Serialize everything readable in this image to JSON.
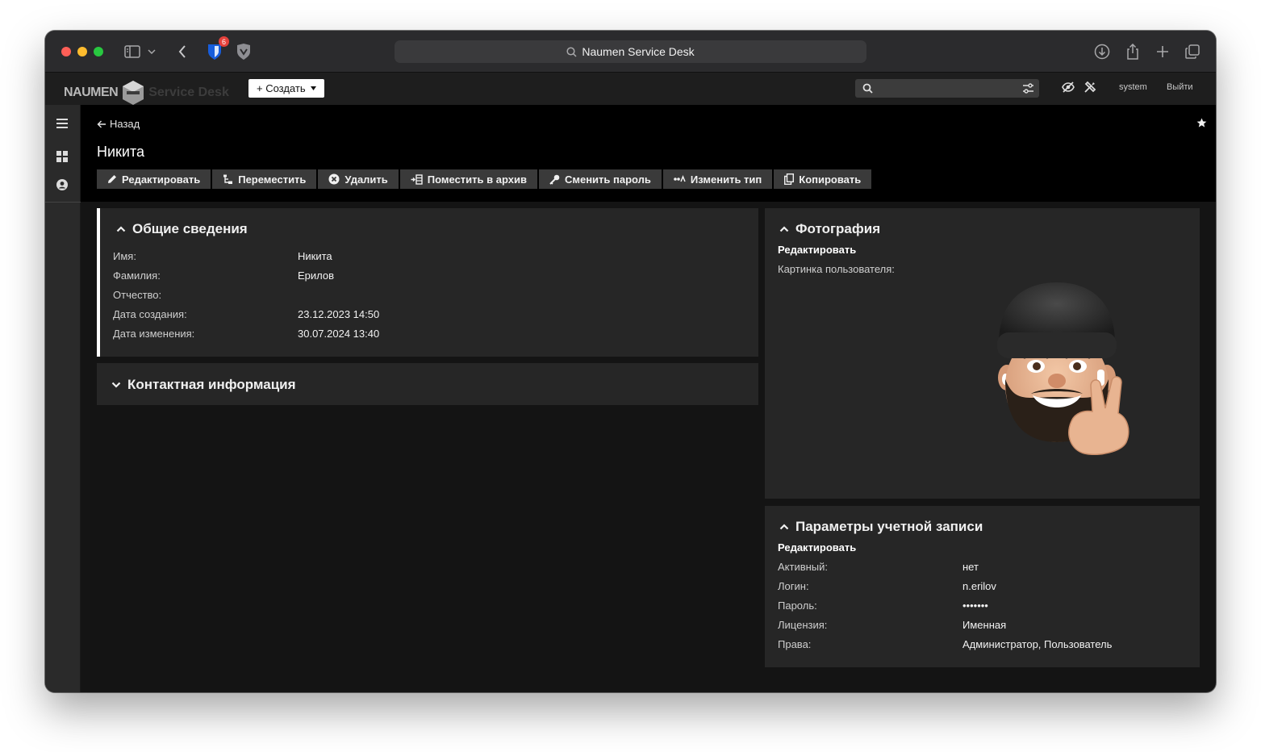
{
  "browser": {
    "address_text": "Naumen Service Desk",
    "extension_badge": "6"
  },
  "app": {
    "logo_text": "NAUMEN",
    "logo_sub": "Service Desk",
    "create_label": "+ Создать",
    "user_label": "system",
    "logout_label": "Выйти",
    "search_placeholder": ""
  },
  "page": {
    "back_label": "Назад",
    "title": "Никита",
    "actions": [
      {
        "label": "Редактировать",
        "icon": "pencil-icon"
      },
      {
        "label": "Переместить",
        "icon": "move-icon"
      },
      {
        "label": "Удалить",
        "icon": "delete-icon"
      },
      {
        "label": "Поместить в архив",
        "icon": "archive-icon"
      },
      {
        "label": "Сменить пароль",
        "icon": "key-icon"
      },
      {
        "label": "Изменить тип",
        "icon": "change-type-icon"
      },
      {
        "label": "Копировать",
        "icon": "copy-icon"
      }
    ]
  },
  "general": {
    "title": "Общие сведения",
    "rows": [
      {
        "label": "Имя:",
        "value": "Никита"
      },
      {
        "label": "Фамилия:",
        "value": "Ерилов"
      },
      {
        "label": "Отчество:",
        "value": ""
      },
      {
        "label": "Дата создания:",
        "value": "23.12.2023 14:50"
      },
      {
        "label": "Дата изменения:",
        "value": "30.07.2024 13:40"
      }
    ]
  },
  "contact": {
    "title": "Контактная информация"
  },
  "photo": {
    "title": "Фотография",
    "edit_label": "Редактировать",
    "picture_label": "Картинка пользователя:"
  },
  "account": {
    "title": "Параметры учетной записи",
    "edit_label": "Редактировать",
    "rows": [
      {
        "label": "Активный:",
        "value": "нет"
      },
      {
        "label": "Логин:",
        "value": "n.erilov"
      },
      {
        "label": "Пароль:",
        "value": "•••••••"
      },
      {
        "label": "Лицензия:",
        "value": "Именная"
      },
      {
        "label": "Права:",
        "value": "Администратор, Пользователь"
      }
    ]
  },
  "colors": {
    "window_bg": "#141414",
    "panel_bg": "#262626",
    "header_bg": "#000000",
    "accent_border": "#ffffff"
  }
}
